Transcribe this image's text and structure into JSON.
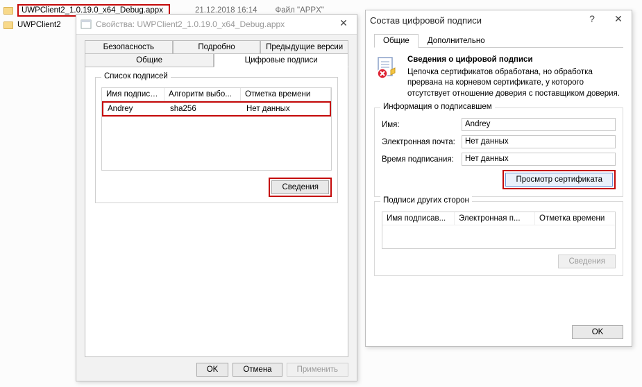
{
  "explorer": {
    "file_name": "UWPClient2_1.0.19.0_x64_Debug.appx",
    "file_date": "21.12.2018 16:14",
    "file_type": "Файл \"APPX\"",
    "file2": "UWPClient2"
  },
  "dlg1": {
    "title": "Свойства: UWPClient2_1.0.19.0_x64_Debug.appx",
    "tabs": {
      "security": "Безопасность",
      "details": "Подробно",
      "prev": "Предыдущие версии",
      "general": "Общие",
      "digsig": "Цифровые подписи"
    },
    "group": "Список подписей",
    "cols": {
      "a": "Имя подписав...",
      "b": "Алгоритм выбо...",
      "c": "Отметка времени"
    },
    "row": {
      "a": "Andrey",
      "b": "sha256",
      "c": "Нет данных"
    },
    "details_btn": "Сведения",
    "ok": "OK",
    "cancel": "Отмена",
    "apply": "Применить"
  },
  "dlg2": {
    "title": "Состав цифровой подписи",
    "help": "?",
    "close": "✕",
    "tabs": {
      "general": "Общие",
      "adv": "Дополнительно"
    },
    "info_title": "Сведения о цифровой подписи",
    "info_body": "Цепочка сертификатов обработана, но обработка прервана на корневом сертификате, у которого отсутствует отношение доверия с поставщиком доверия.",
    "signer_group": "Информация о подписавшем",
    "name_label": "Имя:",
    "name_val": "Andrey",
    "email_label": "Электронная почта:",
    "email_val": "Нет данных",
    "time_label": "Время подписания:",
    "time_val": "Нет данных",
    "view_cert": "Просмотр сертификата",
    "counter_group": "Подписи других сторон",
    "cols": {
      "a": "Имя подписав...",
      "b": "Электронная п...",
      "c": "Отметка времени"
    },
    "details_btn": "Сведения",
    "ok": "OK"
  }
}
